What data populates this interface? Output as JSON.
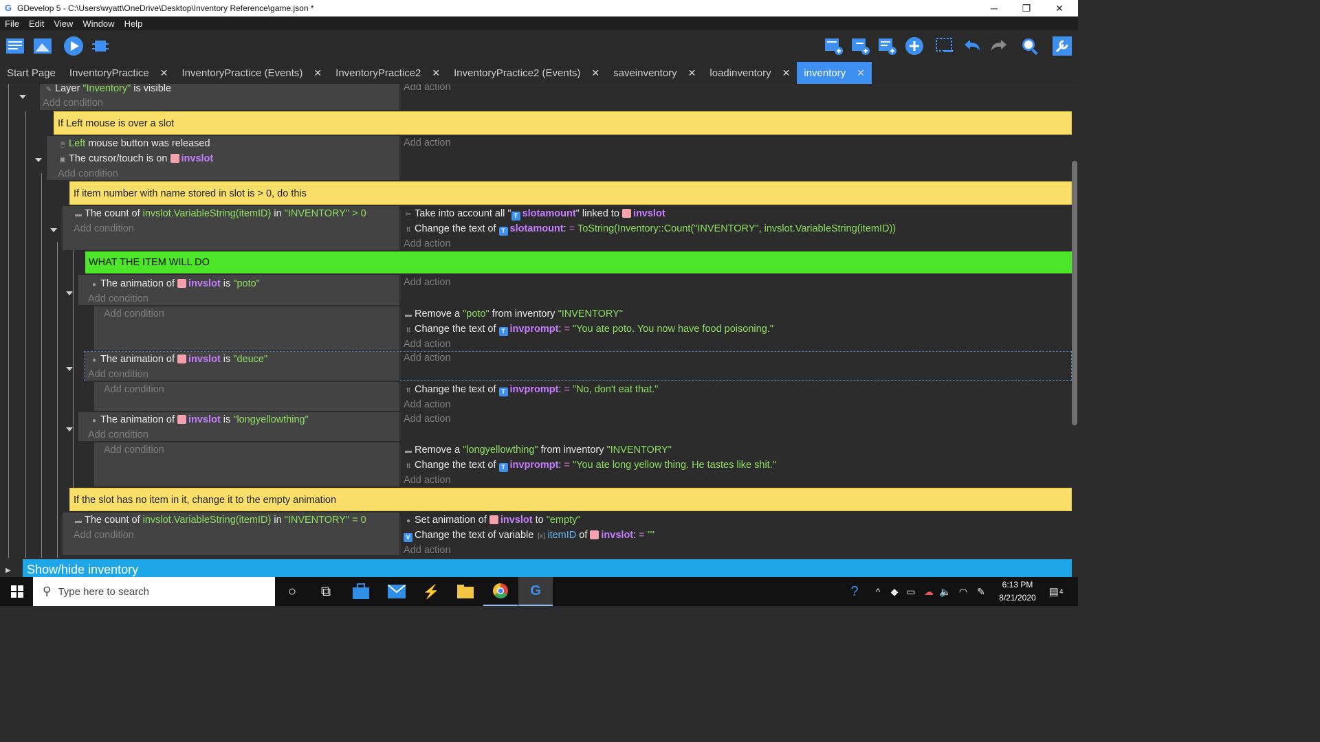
{
  "window": {
    "title": "GDevelop 5 - C:\\Users\\wyatt\\OneDrive\\Desktop\\Inventory Reference\\game.json *",
    "minimize": "─",
    "maximize": "❐",
    "close": "✕"
  },
  "menu": [
    "File",
    "Edit",
    "View",
    "Window",
    "Help"
  ],
  "tabs": [
    {
      "label": "Start Page"
    },
    {
      "label": "InventoryPractice",
      "close": "✕"
    },
    {
      "label": "InventoryPractice (Events)",
      "close": "✕"
    },
    {
      "label": "InventoryPractice2",
      "close": "✕"
    },
    {
      "label": "InventoryPractice2 (Events)",
      "close": "✕"
    },
    {
      "label": "saveinventory",
      "close": "✕"
    },
    {
      "label": "loadinventory",
      "close": "✕"
    },
    {
      "label": "inventory",
      "close": "✕"
    }
  ],
  "common": {
    "add_condition": "Add condition",
    "add_action": "Add action"
  },
  "e1": {
    "c1a": "Layer ",
    "c1b": "\"Inventory\"",
    "c1c": " is visible"
  },
  "comments": {
    "c1": "If Left mouse is over a slot",
    "c2": "If item number with name stored in slot is > 0, do this",
    "c3": "WHAT THE ITEM WILL DO",
    "c4": "If the slot has no item in it, change it to the empty animation"
  },
  "e2": {
    "c1a": "Left",
    "c1b": " mouse button was released",
    "c2a": "The cursor/touch is on ",
    "c2b": "invslot"
  },
  "e3": {
    "c1a": "The count of ",
    "c1b": "invslot.VariableString(itemID)",
    "c1c": " in ",
    "c1d": "\"INVENTORY\"",
    "c1e": " > 0",
    "a1a": "Take into account all \"",
    "a1b": "slotamount",
    "a1c": "\" linked to ",
    "a1d": "invslot",
    "a2a": "Change the text of ",
    "a2b": "slotamount",
    "a2c": ": ",
    "a2d": "= ",
    "a2e": "ToString(Inventory::Count(\"INVENTORY\", invslot.VariableString(itemID))"
  },
  "anim": {
    "pre": "The animation of ",
    "obj": "invslot",
    "is": " is ",
    "poto": "\"poto\"",
    "deuce": "\"deuce\"",
    "long": "\"longyellowthing\""
  },
  "acts": {
    "remove": "Remove a ",
    "from": " from inventory ",
    "inv": "\"INVENTORY\"",
    "poto": "\"poto\"",
    "long": "\"longyellowthing\"",
    "change": "Change the text of ",
    "invprompt": "invprompt",
    "colon": ": ",
    "eq": "= ",
    "msg_poto": "\"You ate poto. You now have food poisoning.\"",
    "msg_deuce": "\"No, don't eat that.\"",
    "msg_long": "\"You ate long yellow thing. He tastes like shit.\""
  },
  "e4": {
    "c1a": "The count of ",
    "c1b": "invslot.VariableString(itemID)",
    "c1c": " in ",
    "c1d": "\"INVENTORY\"",
    "c1e": " = 0",
    "a1a": "Set animation of ",
    "a1b": "invslot",
    "a1c": " to ",
    "a1d": "\"empty\"",
    "a2a": "Change the text of variable ",
    "a2b": "itemID",
    "a2c": " of ",
    "a2d": "invslot",
    "a2e": ": ",
    "a2f": "= ",
    "a2g": "\"\""
  },
  "group": {
    "label": "Show/hide inventory"
  },
  "taskbar": {
    "search_placeholder": "Type here to search",
    "time": "6:13 PM",
    "date": "8/21/2020",
    "notifications": "4"
  },
  "colors": {
    "accent": "#3d8ff0",
    "comment": "#fadf6a",
    "green_comment": "#4de52a",
    "group": "#1ea7e8",
    "object": "#c77dff",
    "value": "#8de05e"
  }
}
